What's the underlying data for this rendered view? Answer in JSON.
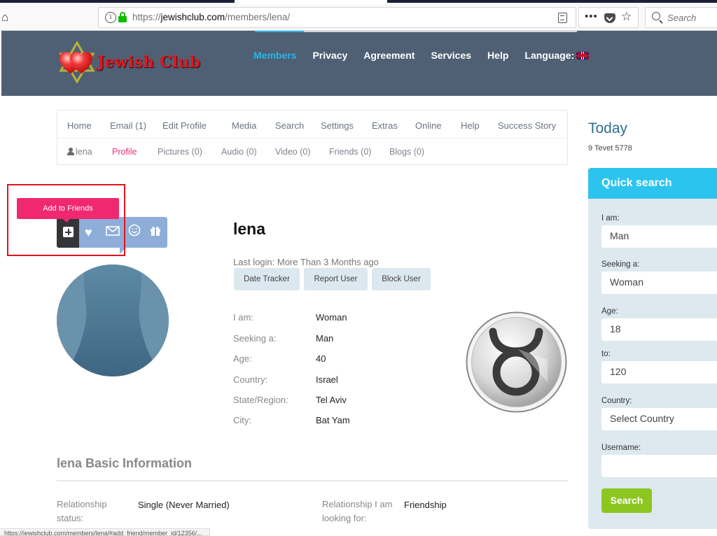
{
  "browser": {
    "url_prefix": "https://",
    "url_domain": "jewishclub.com",
    "url_path": "/members/lena/",
    "search_placeholder": "Search",
    "more_label": "•••",
    "status_text": "https://jewishclub.com/members/lena/#add_friend/member_id/12356/..."
  },
  "header": {
    "logo_text": "Jewish Club",
    "nav": [
      {
        "label": "Members",
        "active": true
      },
      {
        "label": "Privacy"
      },
      {
        "label": "Agreement"
      },
      {
        "label": "Services"
      },
      {
        "label": "Help"
      },
      {
        "label": "Language:"
      }
    ],
    "accent": "#2cb3e8"
  },
  "subnav": {
    "row1": [
      "Home",
      "Email (1)",
      "Edit Profile",
      "Media",
      "Search",
      "Settings",
      "Extras",
      "Online",
      "Help",
      "Success Story"
    ],
    "row2": [
      "lena",
      "Profile",
      "Pictures (0)",
      "Audio (0)",
      "Video (0)",
      "Friends (0)",
      "Blogs (0)"
    ],
    "active_row2": "Profile",
    "active_color": "#ec2f79"
  },
  "profile": {
    "tooltip": "Add to Friends",
    "actions": [
      "add-friend",
      "favorite",
      "message",
      "wink",
      "gift"
    ],
    "name": "lena",
    "last_login": "Last login: More Than 3 Months ago",
    "buttons": [
      "Date Tracker",
      "Report User",
      "Block User"
    ],
    "details": [
      {
        "label": "I am:",
        "value": "Woman"
      },
      {
        "label": "Seeking a:",
        "value": "Man"
      },
      {
        "label": "Age:",
        "value": "40"
      },
      {
        "label": "Country:",
        "value": "Israel"
      },
      {
        "label": "State/Region:",
        "value": "Tel Aviv"
      },
      {
        "label": "City:",
        "value": "Bat Yam"
      }
    ],
    "zodiac": "Taurus"
  },
  "basic_info": {
    "title": "lena Basic Information",
    "items": [
      {
        "label": "Relationship status:",
        "value": "Single (Never Married)"
      },
      {
        "label": "Relationship I am looking for:",
        "value": "Friendship"
      }
    ]
  },
  "sidebar": {
    "today_title": "Today",
    "today_date": "9 Tevet 5778",
    "quick_search": {
      "title": "Quick search",
      "fields": [
        {
          "label": "I am:",
          "value": "Man"
        },
        {
          "label": "Seeking a:",
          "value": "Woman"
        },
        {
          "label": "Age:",
          "value": "18"
        },
        {
          "label": "to:",
          "value": "120"
        },
        {
          "label": "Country:",
          "value": "Select Country"
        },
        {
          "label": "Username:",
          "value": ""
        }
      ],
      "button": "Search",
      "button_color": "#8dc621",
      "header_color": "#2cc4ef"
    }
  }
}
